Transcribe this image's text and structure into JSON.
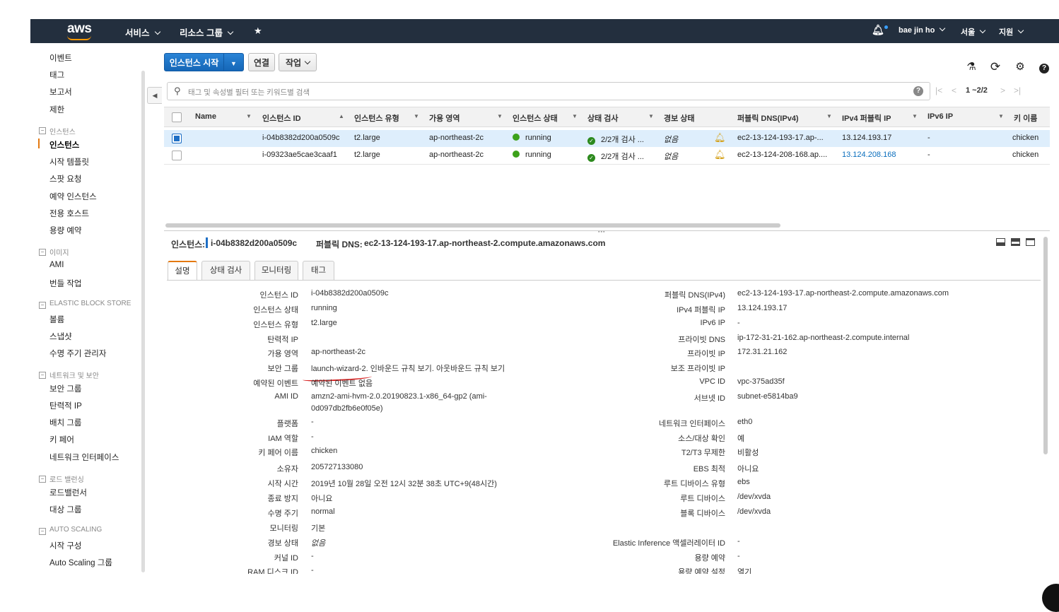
{
  "topnav": {
    "logo": "aws",
    "services": "서비스",
    "resource_groups": "리소스 그룹",
    "user": "bae jin ho",
    "region": "서울",
    "support": "지원"
  },
  "sidebar": {
    "items_top": [
      "이벤트",
      "태그",
      "보고서",
      "제한"
    ],
    "sections": [
      {
        "header": "인스턴스",
        "items": [
          "인스턴스",
          "시작 템플릿",
          "스팟 요청",
          "예약 인스턴스",
          "전용 호스트",
          "용량 예약"
        ]
      },
      {
        "header": "이미지",
        "items": [
          "AMI",
          "번들 작업"
        ]
      },
      {
        "header": "ELASTIC BLOCK STORE",
        "items": [
          "볼륨",
          "스냅샷",
          "수명 주기 관리자"
        ]
      },
      {
        "header": "네트워크 및 보안",
        "items": [
          "보안 그룹",
          "탄력적 IP",
          "배치 그룹",
          "키 페어",
          "네트워크 인터페이스"
        ]
      },
      {
        "header": "로드 밸런싱",
        "items": [
          "로드밸런서",
          "대상 그룹"
        ]
      },
      {
        "header": "AUTO SCALING",
        "items": [
          "시작 구성",
          "Auto Scaling 그룹"
        ]
      }
    ]
  },
  "toolbar": {
    "launch_label": "인스턴스 시작",
    "connect_label": "연결",
    "actions_label": "작업"
  },
  "search": {
    "placeholder": "태그 및 속성별 필터 또는 키워드별 검색",
    "pagination": "1 ~2/2"
  },
  "table": {
    "columns": [
      "Name",
      "인스턴스 ID",
      "인스턴스 유형",
      "가용 영역",
      "인스턴스 상태",
      "상태 검사",
      "경보 상태",
      "퍼블릭 DNS(IPv4)",
      "IPv4 퍼블릭 IP",
      "IPv6 IP",
      "키 이름"
    ],
    "rows": [
      {
        "name": "",
        "id": "i-04b8382d200a0509c",
        "type": "t2.large",
        "az": "ap-northeast-2c",
        "state": "running",
        "status": "2/2개 검사 ...",
        "alarm": "없음",
        "dns": "ec2-13-124-193-17.ap-...",
        "ip": "13.124.193.17",
        "ipv6": "-",
        "key": "chicken",
        "selected": true
      },
      {
        "name": "",
        "id": "i-09323ae5cae3caaf1",
        "type": "t2.large",
        "az": "ap-northeast-2c",
        "state": "running",
        "status": "2/2개 검사 ...",
        "alarm": "없음",
        "dns": "ec2-13-124-208-168.ap....",
        "ip": "13.124.208.168",
        "ipv6": "-",
        "key": "chicken",
        "selected": false
      }
    ]
  },
  "detail": {
    "instance_label": "인스턴스:",
    "instance_id": "i-04b8382d200a0509c",
    "public_dns_label": "퍼블릭 DNS:",
    "public_dns": "ec2-13-124-193-17.ap-northeast-2.compute.amazonaws.com",
    "tabs": [
      "설명",
      "상태 검사",
      "모니터링",
      "태그"
    ],
    "left_fields": [
      {
        "label": "인스턴스 ID",
        "value": "i-04b8382d200a0509c"
      },
      {
        "label": "인스턴스 상태",
        "value": "running"
      },
      {
        "label": "인스턴스 유형",
        "value": "t2.large"
      },
      {
        "label": "탄력적 IP",
        "value": ""
      },
      {
        "label": "가용 영역",
        "value": "ap-northeast-2c"
      },
      {
        "label": "보안 그룹",
        "value": "launch-wizard-2. 인바운드 규칙 보기. 아웃바운드 규칙 보기"
      },
      {
        "label": "예약된 이벤트",
        "value": "예약된 이벤트 없음"
      },
      {
        "label": "AMI ID",
        "value": "amzn2-ami-hvm-2.0.20190823.1-x86_64-gp2 (ami-",
        "value2": "0d097db2fb6e0f05e)"
      },
      {
        "label": "플랫폼",
        "value": "-"
      },
      {
        "label": "IAM 역할",
        "value": "-"
      },
      {
        "label": "키 페어 이름",
        "value": "chicken"
      },
      {
        "label": "소유자",
        "value": "205727133080"
      },
      {
        "label": "시작 시간",
        "value": "2019년 10월 28일 오전 12시 32분 38초 UTC+9(48시간)"
      },
      {
        "label": "종료 방지",
        "value": "아니요"
      },
      {
        "label": "수명 주기",
        "value": "normal"
      },
      {
        "label": "모니터링",
        "value": "기본"
      },
      {
        "label": "경보 상태",
        "value": "없음"
      },
      {
        "label": "커널 ID",
        "value": "-"
      },
      {
        "label": "RAM 디스크 ID",
        "value": "-"
      }
    ],
    "right_fields": [
      {
        "label": "퍼블릭 DNS(IPv4)",
        "value": "ec2-13-124-193-17.ap-northeast-2.compute.amazonaws.com"
      },
      {
        "label": "IPv4 퍼블릭 IP",
        "value": "13.124.193.17"
      },
      {
        "label": "IPv6 IP",
        "value": "-"
      },
      {
        "label": "프라이빗 DNS",
        "value": "ip-172-31-21-162.ap-northeast-2.compute.internal"
      },
      {
        "label": "프라이빗 IP",
        "value": "172.31.21.162"
      },
      {
        "label": "보조 프라이빗 IP",
        "value": ""
      },
      {
        "label": "VPC ID",
        "value": "vpc-375ad35f"
      },
      {
        "label": "서브넷 ID",
        "value": "subnet-e5814ba9"
      },
      {
        "label": "네트워크 인터페이스",
        "value": "eth0"
      },
      {
        "label": "소스/대상 확인",
        "value": "예"
      },
      {
        "label": "T2/T3 무제한",
        "value": "비활성"
      },
      {
        "label": "EBS 최적",
        "value": "아니요"
      },
      {
        "label": "루트 디바이스 유형",
        "value": "ebs"
      },
      {
        "label": "루트 디바이스",
        "value": "/dev/xvda"
      },
      {
        "label": "블록 디바이스",
        "value": "/dev/xvda"
      },
      {
        "label": "Elastic Inference 액셀러레이터 ID",
        "value": "-"
      },
      {
        "label": "용량 예약",
        "value": "-"
      },
      {
        "label": "용량 예약 설정",
        "value": "열기"
      }
    ]
  }
}
